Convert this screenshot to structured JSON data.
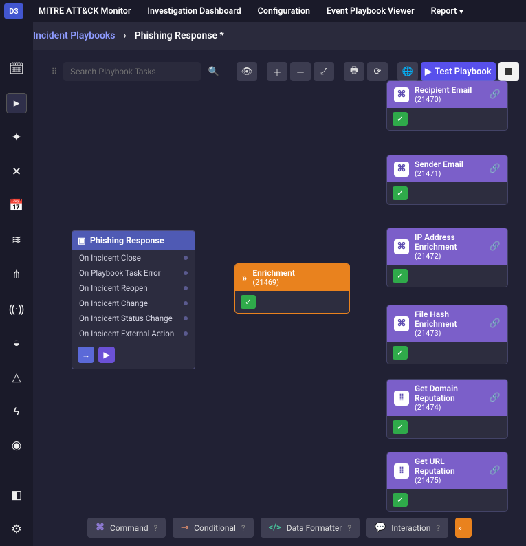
{
  "top_nav": {
    "items": [
      "MITRE ATT&CK Monitor",
      "Investigation Dashboard",
      "Configuration",
      "Event Playbook Viewer",
      "Report"
    ]
  },
  "breadcrumb": {
    "root": "Incident Playbooks",
    "leaf": "Phishing Response *"
  },
  "toolbar": {
    "search_placeholder": "Search Playbook Tasks",
    "test_label": "Test Playbook"
  },
  "start_node": {
    "title": "Phishing Response",
    "triggers": [
      "On Incident Close",
      "On Playbook Task Error",
      "On Incident Reopen",
      "On Incident Change",
      "On Incident Status Change",
      "On Incident External Action"
    ]
  },
  "enrichment_node": {
    "title": "Enrichment",
    "id": "(21469)"
  },
  "child_nodes": [
    {
      "title": "Recipient Email",
      "id": "(21470)",
      "icon_type": "cmd"
    },
    {
      "title": "Sender Email",
      "id": "(21471)",
      "icon_type": "cmd"
    },
    {
      "title": "IP Address Enrichment",
      "id": "(21472)",
      "icon_type": "cmd"
    },
    {
      "title": "File Hash Enrichment",
      "id": "(21473)",
      "icon_type": "cmd"
    },
    {
      "title": "Get Domain Reputation",
      "id": "(21474)",
      "icon_type": "int"
    },
    {
      "title": "Get URL Reputation",
      "id": "(21475)",
      "icon_type": "int"
    }
  ],
  "bottom_chips": {
    "command": "Command",
    "conditional": "Conditional",
    "formatter": "Data Formatter",
    "interaction": "Interaction"
  }
}
